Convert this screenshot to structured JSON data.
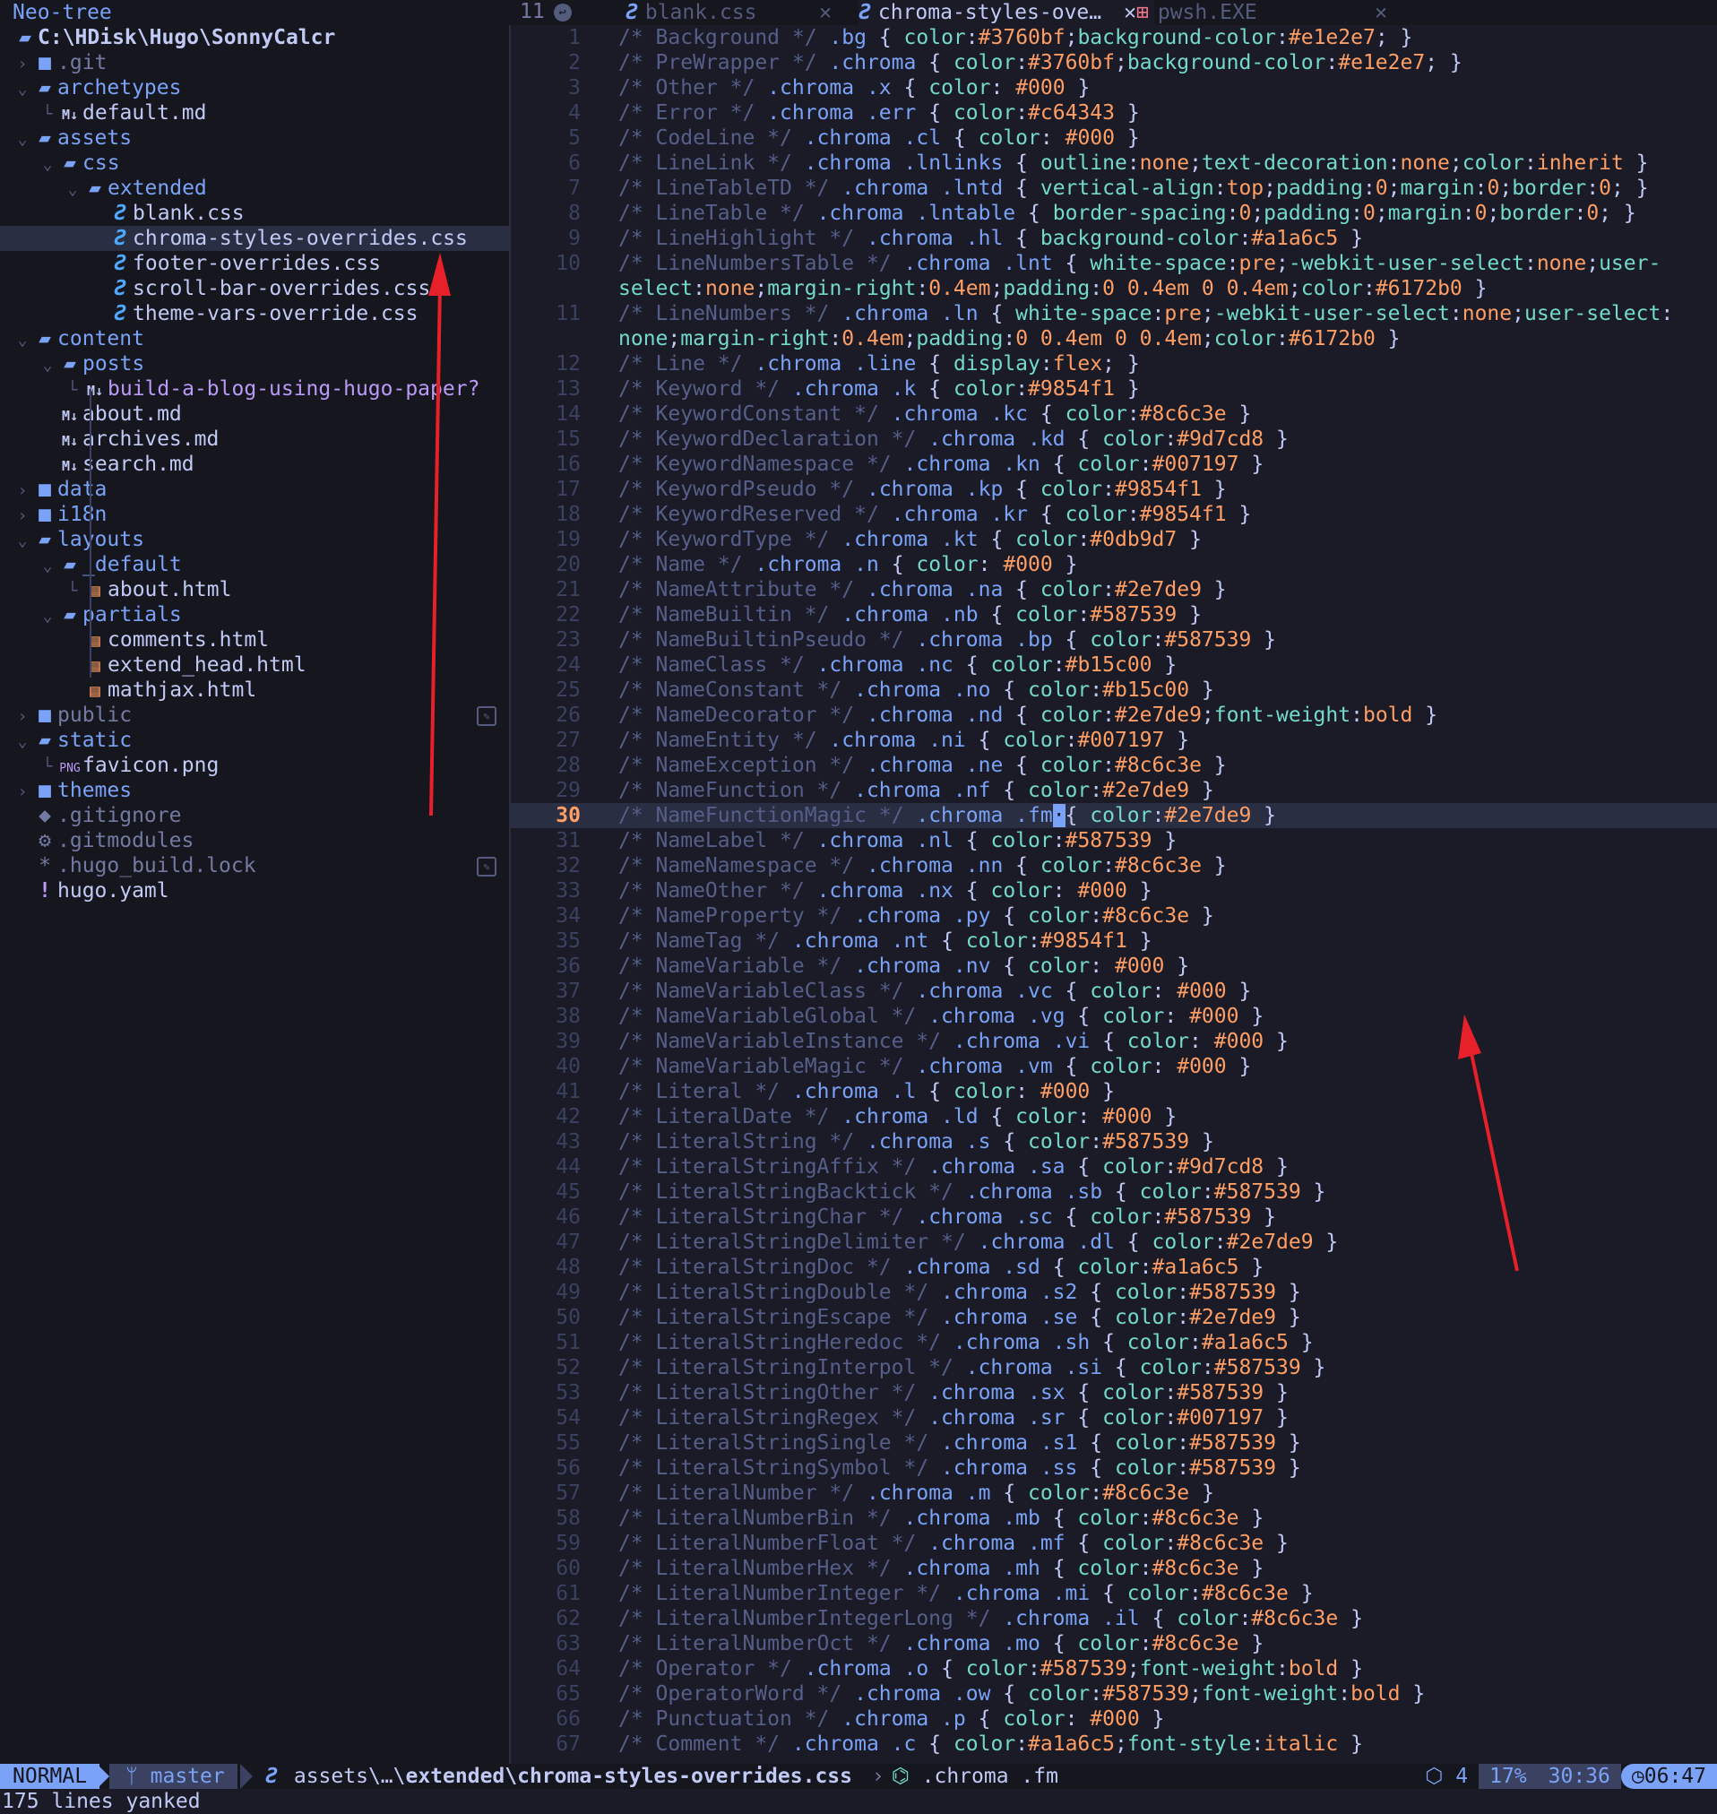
{
  "sidebar": {
    "title": "Neo-tree",
    "rows": [
      {
        "depth": 0,
        "chev": "",
        "icon": "folder-open",
        "name": "C:\\HDisk\\Hugo\\SonnyCalcr",
        "cls": "root"
      },
      {
        "depth": 0,
        "chev": "›",
        "icon": "folder",
        "name": ".git",
        "cls": "dim"
      },
      {
        "depth": 0,
        "chev": "⌄",
        "icon": "folder-open",
        "name": "archetypes"
      },
      {
        "depth": 1,
        "chev": "└",
        "icon": "md",
        "name": "default.md"
      },
      {
        "depth": 0,
        "chev": "⌄",
        "icon": "folder-open",
        "name": "assets"
      },
      {
        "depth": 1,
        "chev": "⌄",
        "icon": "folder-open",
        "name": "css"
      },
      {
        "depth": 2,
        "chev": "⌄",
        "icon": "folder-open",
        "name": "extended"
      },
      {
        "depth": 3,
        "chev": "",
        "icon": "css",
        "name": "blank.css"
      },
      {
        "depth": 3,
        "chev": "",
        "icon": "css",
        "name": "chroma-styles-overrides.css",
        "selected": true
      },
      {
        "depth": 3,
        "chev": "",
        "icon": "css",
        "name": "footer-overrides.css"
      },
      {
        "depth": 3,
        "chev": "",
        "icon": "css",
        "name": "scroll-bar-overrides.css"
      },
      {
        "depth": 3,
        "chev": "",
        "icon": "css",
        "name": "theme-vars-override.css"
      },
      {
        "depth": 0,
        "chev": "⌄",
        "icon": "folder-open",
        "name": "content"
      },
      {
        "depth": 1,
        "chev": "⌄",
        "icon": "folder-open",
        "name": "posts"
      },
      {
        "depth": 2,
        "chev": "└",
        "icon": "md",
        "name": "build-a-blog-using-hugo-paper",
        "suffix": "?"
      },
      {
        "depth": 1,
        "chev": "",
        "icon": "md",
        "name": "about.md"
      },
      {
        "depth": 1,
        "chev": "",
        "icon": "md",
        "name": "archives.md"
      },
      {
        "depth": 1,
        "chev": "",
        "icon": "md",
        "name": "search.md"
      },
      {
        "depth": 0,
        "chev": "›",
        "icon": "folder",
        "name": "data"
      },
      {
        "depth": 0,
        "chev": "›",
        "icon": "folder",
        "name": "i18n"
      },
      {
        "depth": 0,
        "chev": "⌄",
        "icon": "folder-open",
        "name": "layouts"
      },
      {
        "depth": 1,
        "chev": "⌄",
        "icon": "folder-open",
        "name": "_default"
      },
      {
        "depth": 2,
        "chev": "└",
        "icon": "html",
        "name": "about.html"
      },
      {
        "depth": 1,
        "chev": "⌄",
        "icon": "folder-open",
        "name": "partials"
      },
      {
        "depth": 2,
        "chev": "",
        "icon": "html",
        "name": "comments.html"
      },
      {
        "depth": 2,
        "chev": "",
        "icon": "html",
        "name": "extend_head.html"
      },
      {
        "depth": 2,
        "chev": "",
        "icon": "html",
        "name": "mathjax.html"
      },
      {
        "depth": 0,
        "chev": "›",
        "icon": "folder",
        "name": "public",
        "cls": "dim",
        "badge": true
      },
      {
        "depth": 0,
        "chev": "⌄",
        "icon": "folder-open",
        "name": "static"
      },
      {
        "depth": 1,
        "chev": "└",
        "icon": "png",
        "name": "favicon.png"
      },
      {
        "depth": 0,
        "chev": "›",
        "icon": "folder",
        "name": "themes"
      },
      {
        "depth": 0,
        "chev": "",
        "icon": "git",
        "name": ".gitignore",
        "cls": "dim"
      },
      {
        "depth": 0,
        "chev": "",
        "icon": "gear",
        "name": ".gitmodules",
        "cls": "dim"
      },
      {
        "depth": 0,
        "chev": "",
        "icon": "star",
        "name": ".hugo_build.lock",
        "cls": "dim",
        "badge": true
      },
      {
        "depth": 0,
        "chev": "",
        "icon": "yaml",
        "name": "hugo.yaml"
      }
    ]
  },
  "tabs": {
    "count": "11",
    "items": [
      {
        "label": "blank.css",
        "icon": "css",
        "active": false
      },
      {
        "label": "chroma-styles-ove…",
        "icon": "css",
        "active": true
      },
      {
        "label": "pwsh.EXE",
        "icon": "windows",
        "active": false
      }
    ],
    "close_glyph": "✕"
  },
  "editor": {
    "current_line": 30,
    "lines": [
      {
        "n": "1",
        "c": "Background",
        "s": ".bg",
        "d": "color:#3760bf;background-color:#e1e2e7;",
        "x": true
      },
      {
        "n": "2",
        "c": "PreWrapper",
        "s": ".chroma",
        "d": "color:#3760bf;background-color:#e1e2e7;"
      },
      {
        "n": "3",
        "c": "Other",
        "s": ".chroma .x",
        "d": "color: #000"
      },
      {
        "n": "4",
        "c": "Error",
        "s": ".chroma .err",
        "d": "color:#c64343"
      },
      {
        "n": "5",
        "c": "CodeLine",
        "s": ".chroma .cl",
        "d": "color: #000"
      },
      {
        "n": "6",
        "c": "LineLink",
        "s": ".chroma .lnlinks",
        "d": "outline:none;text-decoration:none;color:inherit"
      },
      {
        "n": "7",
        "c": "LineTableTD",
        "s": ".chroma .lntd",
        "d": "vertical-align:top;padding:0;margin:0;border:0;"
      },
      {
        "n": "8",
        "c": "LineTable",
        "s": ".chroma .lntable",
        "d": "border-spacing:0;padding:0;margin:0;border:0;"
      },
      {
        "n": "9",
        "c": "LineHighlight",
        "s": ".chroma .hl",
        "d": "background-color:#a1a6c5"
      },
      {
        "n": "10",
        "c": "LineNumbersTable",
        "s": ".chroma .lnt",
        "d": "white-space:pre;-webkit-user-select:none;user-",
        "w": "select:none;margin-right:0.4em;padding:0 0.4em 0 0.4em;color:#6172b0 }"
      },
      {
        "n": "11",
        "c": "LineNumbers",
        "s": ".chroma .ln",
        "d": "white-space:pre;-webkit-user-select:none;user-select:",
        "w": "none;margin-right:0.4em;padding:0 0.4em 0 0.4em;color:#6172b0 }"
      },
      {
        "n": "12",
        "c": "Line",
        "s": ".chroma .line",
        "d": "display:flex;"
      },
      {
        "n": "13",
        "c": "Keyword",
        "s": ".chroma .k",
        "d": "color:#9854f1"
      },
      {
        "n": "14",
        "c": "KeywordConstant",
        "s": ".chroma .kc",
        "d": "color:#8c6c3e"
      },
      {
        "n": "15",
        "c": "KeywordDeclaration",
        "s": ".chroma .kd",
        "d": "color:#9d7cd8"
      },
      {
        "n": "16",
        "c": "KeywordNamespace",
        "s": ".chroma .kn",
        "d": "color:#007197"
      },
      {
        "n": "17",
        "c": "KeywordPseudo",
        "s": ".chroma .kp",
        "d": "color:#9854f1"
      },
      {
        "n": "18",
        "c": "KeywordReserved",
        "s": ".chroma .kr",
        "d": "color:#9854f1"
      },
      {
        "n": "19",
        "c": "KeywordType",
        "s": ".chroma .kt",
        "d": "color:#0db9d7"
      },
      {
        "n": "20",
        "c": "Name",
        "s": ".chroma .n",
        "d": "color: #000"
      },
      {
        "n": "21",
        "c": "NameAttribute",
        "s": ".chroma .na",
        "d": "color:#2e7de9"
      },
      {
        "n": "22",
        "c": "NameBuiltin",
        "s": ".chroma .nb",
        "d": "color:#587539"
      },
      {
        "n": "23",
        "c": "NameBuiltinPseudo",
        "s": ".chroma .bp",
        "d": "color:#587539"
      },
      {
        "n": "24",
        "c": "NameClass",
        "s": ".chroma .nc",
        "d": "color:#b15c00"
      },
      {
        "n": "25",
        "c": "NameConstant",
        "s": ".chroma .no",
        "d": "color:#b15c00"
      },
      {
        "n": "26",
        "c": "NameDecorator",
        "s": ".chroma .nd",
        "d": "color:#2e7de9;font-weight:bold"
      },
      {
        "n": "27",
        "c": "NameEntity",
        "s": ".chroma .ni",
        "d": "color:#007197"
      },
      {
        "n": "28",
        "c": "NameException",
        "s": ".chroma .ne",
        "d": "color:#8c6c3e"
      },
      {
        "n": "29",
        "c": "NameFunction",
        "s": ".chroma .nf",
        "d": "color:#2e7de9"
      },
      {
        "n": "30",
        "c": "NameFunctionMagic",
        "s": ".chroma .fm",
        "d": "color:#2e7de9",
        "cursor": true
      },
      {
        "n": "31",
        "c": "NameLabel",
        "s": ".chroma .nl",
        "d": "color:#587539"
      },
      {
        "n": "32",
        "c": "NameNamespace",
        "s": ".chroma .nn",
        "d": "color:#8c6c3e"
      },
      {
        "n": "33",
        "c": "NameOther",
        "s": ".chroma .nx",
        "d": "color: #000"
      },
      {
        "n": "34",
        "c": "NameProperty",
        "s": ".chroma .py",
        "d": "color:#8c6c3e"
      },
      {
        "n": "35",
        "c": "NameTag",
        "s": ".chroma .nt",
        "d": "color:#9854f1"
      },
      {
        "n": "36",
        "c": "NameVariable",
        "s": ".chroma .nv",
        "d": "color: #000"
      },
      {
        "n": "37",
        "c": "NameVariableClass",
        "s": ".chroma .vc",
        "d": "color: #000"
      },
      {
        "n": "38",
        "c": "NameVariableGlobal",
        "s": ".chroma .vg",
        "d": "color: #000"
      },
      {
        "n": "39",
        "c": "NameVariableInstance",
        "s": ".chroma .vi",
        "d": "color: #000"
      },
      {
        "n": "40",
        "c": "NameVariableMagic",
        "s": ".chroma .vm",
        "d": "color: #000"
      },
      {
        "n": "41",
        "c": "Literal",
        "s": ".chroma .l",
        "d": "color: #000"
      },
      {
        "n": "42",
        "c": "LiteralDate",
        "s": ".chroma .ld",
        "d": "color: #000"
      },
      {
        "n": "43",
        "c": "LiteralString",
        "s": ".chroma .s",
        "d": "color:#587539"
      },
      {
        "n": "44",
        "c": "LiteralStringAffix",
        "s": ".chroma .sa",
        "d": "color:#9d7cd8"
      },
      {
        "n": "45",
        "c": "LiteralStringBacktick",
        "s": ".chroma .sb",
        "d": "color:#587539"
      },
      {
        "n": "46",
        "c": "LiteralStringChar",
        "s": ".chroma .sc",
        "d": "color:#587539"
      },
      {
        "n": "47",
        "c": "LiteralStringDelimiter",
        "s": ".chroma .dl",
        "d": "color:#2e7de9"
      },
      {
        "n": "48",
        "c": "LiteralStringDoc",
        "s": ".chroma .sd",
        "d": "color:#a1a6c5"
      },
      {
        "n": "49",
        "c": "LiteralStringDouble",
        "s": ".chroma .s2",
        "d": "color:#587539"
      },
      {
        "n": "50",
        "c": "LiteralStringEscape",
        "s": ".chroma .se",
        "d": "color:#2e7de9"
      },
      {
        "n": "51",
        "c": "LiteralStringHeredoc",
        "s": ".chroma .sh",
        "d": "color:#a1a6c5"
      },
      {
        "n": "52",
        "c": "LiteralStringInterpol",
        "s": ".chroma .si",
        "d": "color:#587539"
      },
      {
        "n": "53",
        "c": "LiteralStringOther",
        "s": ".chroma .sx",
        "d": "color:#587539"
      },
      {
        "n": "54",
        "c": "LiteralStringRegex",
        "s": ".chroma .sr",
        "d": "color:#007197"
      },
      {
        "n": "55",
        "c": "LiteralStringSingle",
        "s": ".chroma .s1",
        "d": "color:#587539"
      },
      {
        "n": "56",
        "c": "LiteralStringSymbol",
        "s": ".chroma .ss",
        "d": "color:#587539"
      },
      {
        "n": "57",
        "c": "LiteralNumber",
        "s": ".chroma .m",
        "d": "color:#8c6c3e"
      },
      {
        "n": "58",
        "c": "LiteralNumberBin",
        "s": ".chroma .mb",
        "d": "color:#8c6c3e"
      },
      {
        "n": "59",
        "c": "LiteralNumberFloat",
        "s": ".chroma .mf",
        "d": "color:#8c6c3e"
      },
      {
        "n": "60",
        "c": "LiteralNumberHex",
        "s": ".chroma .mh",
        "d": "color:#8c6c3e"
      },
      {
        "n": "61",
        "c": "LiteralNumberInteger",
        "s": ".chroma .mi",
        "d": "color:#8c6c3e"
      },
      {
        "n": "62",
        "c": "LiteralNumberIntegerLong",
        "s": ".chroma .il",
        "d": "color:#8c6c3e"
      },
      {
        "n": "63",
        "c": "LiteralNumberOct",
        "s": ".chroma .mo",
        "d": "color:#8c6c3e"
      },
      {
        "n": "64",
        "c": "Operator",
        "s": ".chroma .o",
        "d": "color:#587539;font-weight:bold"
      },
      {
        "n": "65",
        "c": "OperatorWord",
        "s": ".chroma .ow",
        "d": "color:#587539;font-weight:bold"
      },
      {
        "n": "66",
        "c": "Punctuation",
        "s": ".chroma .p",
        "d": "color: #000"
      },
      {
        "n": "67",
        "c": "Comment",
        "s": ".chroma .c",
        "d": "color:#a1a6c5;font-style:italic"
      }
    ]
  },
  "status": {
    "mode": "NORMAL",
    "branch": "master",
    "path_prefix": "assets\\…\\",
    "path_bold": "extended\\chroma-styles-overrides.css",
    "breadcrumb_sep": "›",
    "symbol": ".chroma .fm",
    "lsp_count": "4",
    "percent": "17%",
    "position": "30:36",
    "time": "06:47"
  },
  "cmdline": "175 lines yanked",
  "colors": {
    "accent": "#7aa2f7",
    "comment": "#565f89",
    "property": "#73daca",
    "value": "#ff9e64",
    "annotation_arrow": "#e8202a"
  }
}
